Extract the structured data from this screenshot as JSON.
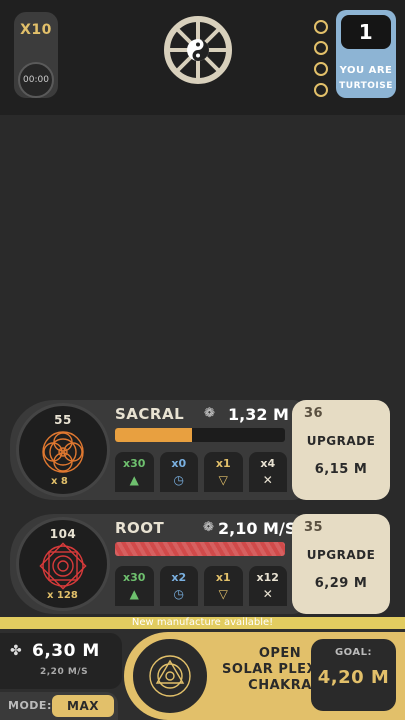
{
  "header": {
    "speed_button": "X10",
    "timer": "00:00",
    "rank": {
      "number": "1",
      "line1": "YOU ARE",
      "line2": "TURTOISE"
    }
  },
  "chakras": [
    {
      "level": "55",
      "multiplier": "x 8",
      "name": "SACRAL",
      "value": "1,32 M",
      "progress": 0.45,
      "bar_color": "#e8a040",
      "boosts": [
        {
          "label": "x30",
          "icon": "triangle-up-icon",
          "color": "#6ec06e"
        },
        {
          "label": "x0",
          "icon": "clock-icon",
          "color": "#7ab0e0"
        },
        {
          "label": "x1",
          "icon": "triangle-down-icon",
          "color": "#e2c06a"
        },
        {
          "label": "x4",
          "icon": "close-icon",
          "color": "#e8e2d2"
        }
      ],
      "upgrade": {
        "count": "36",
        "label": "UPGRADE",
        "cost": "6,15 M"
      }
    },
    {
      "level": "104",
      "multiplier": "x 128",
      "name": "ROOT",
      "value": "2,10 M/S",
      "progress": 1.0,
      "bar_color": "#d04a4a",
      "boosts": [
        {
          "label": "x30",
          "icon": "triangle-up-icon",
          "color": "#6ec06e"
        },
        {
          "label": "x2",
          "icon": "clock-icon",
          "color": "#7ab0e0"
        },
        {
          "label": "x1",
          "icon": "triangle-down-icon",
          "color": "#e2c06a"
        },
        {
          "label": "x12",
          "icon": "close-icon",
          "color": "#e8e2d2"
        }
      ],
      "upgrade": {
        "count": "35",
        "label": "UPGRADE",
        "cost": "6,29 M"
      }
    }
  ],
  "banner": "New manufacture available!",
  "footer": {
    "money": "6,30 M",
    "rate": "2,20 M/S",
    "mode_label": "MODE:",
    "mode_value": "MAX",
    "open_button": {
      "line1": "OPEN",
      "line2": "SOLAR PLEXUS",
      "line3": "CHAKRA"
    },
    "goal_label": "GOAL:",
    "goal_value": "4,20 M"
  }
}
